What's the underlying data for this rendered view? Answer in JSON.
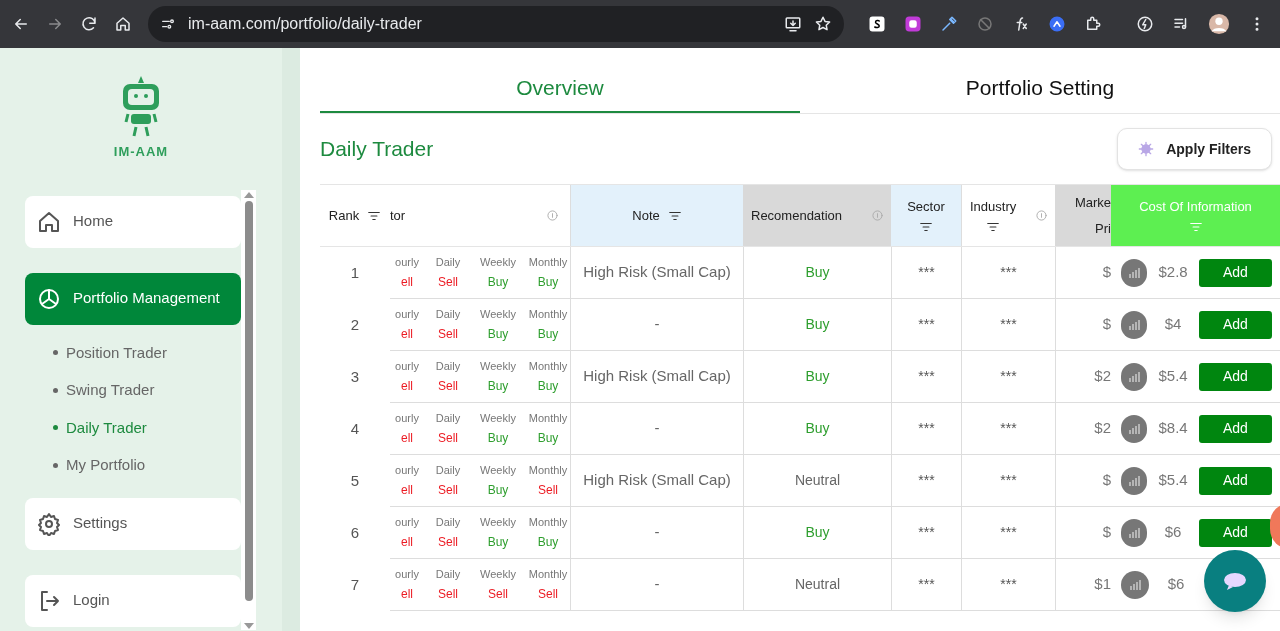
{
  "browser": {
    "url": "im-aam.com/portfolio/daily-trader"
  },
  "sidebar": {
    "logo": "IM-AAM",
    "items": [
      {
        "label": "Home",
        "kind": "home",
        "selected": false
      },
      {
        "label": "Portfolio Management",
        "kind": "chart",
        "selected": true,
        "children": [
          {
            "label": "Position Trader",
            "selected": false
          },
          {
            "label": "Swing Trader",
            "selected": false
          },
          {
            "label": "Daily Trader",
            "selected": true
          },
          {
            "label": "My Portfolio",
            "selected": false
          }
        ]
      },
      {
        "label": "Settings",
        "kind": "gear",
        "selected": false
      },
      {
        "label": "Login",
        "kind": "login",
        "selected": false
      }
    ]
  },
  "tabs": [
    {
      "label": "Overview",
      "selected": true
    },
    {
      "label": "Portfolio Setting",
      "selected": false
    }
  ],
  "title": "Daily Trader",
  "apply_filters": "Apply Filters",
  "table": {
    "columns": [
      "Rank",
      "tor",
      "Note",
      "Recomendation",
      "Sector",
      "Industry",
      "Marke",
      "Pri",
      "Cost Of Information"
    ],
    "rows": [
      {
        "rank": "1",
        "signals": [
          {
            "period": "ourly",
            "value": "ell",
            "kind": "sell"
          },
          {
            "period": "Daily",
            "value": "Sell",
            "kind": "sell"
          },
          {
            "period": "Weekly",
            "value": "Buy",
            "kind": "buy"
          },
          {
            "period": "Monthly",
            "value": "Buy",
            "kind": "buy"
          }
        ],
        "note": "High Risk (Small Cap)",
        "recommendation": {
          "label": "Buy",
          "kind": "buy"
        },
        "sector": "***",
        "industry": "***",
        "market_price": "$",
        "cost": "$2.8",
        "action": "Add"
      },
      {
        "rank": "2",
        "signals": [
          {
            "period": "ourly",
            "value": "ell",
            "kind": "sell"
          },
          {
            "period": "Daily",
            "value": "Sell",
            "kind": "sell"
          },
          {
            "period": "Weekly",
            "value": "Buy",
            "kind": "buy"
          },
          {
            "period": "Monthly",
            "value": "Buy",
            "kind": "buy"
          }
        ],
        "note": "-",
        "recommendation": {
          "label": "Buy",
          "kind": "buy"
        },
        "sector": "***",
        "industry": "***",
        "market_price": "$",
        "cost": "$4",
        "action": "Add"
      },
      {
        "rank": "3",
        "signals": [
          {
            "period": "ourly",
            "value": "ell",
            "kind": "sell"
          },
          {
            "period": "Daily",
            "value": "Sell",
            "kind": "sell"
          },
          {
            "period": "Weekly",
            "value": "Buy",
            "kind": "buy"
          },
          {
            "period": "Monthly",
            "value": "Buy",
            "kind": "buy"
          }
        ],
        "note": "High Risk (Small Cap)",
        "recommendation": {
          "label": "Buy",
          "kind": "buy"
        },
        "sector": "***",
        "industry": "***",
        "market_price": "$2",
        "cost": "$5.4",
        "action": "Add"
      },
      {
        "rank": "4",
        "signals": [
          {
            "period": "ourly",
            "value": "ell",
            "kind": "sell"
          },
          {
            "period": "Daily",
            "value": "Sell",
            "kind": "sell"
          },
          {
            "period": "Weekly",
            "value": "Buy",
            "kind": "buy"
          },
          {
            "period": "Monthly",
            "value": "Buy",
            "kind": "buy"
          }
        ],
        "note": "-",
        "recommendation": {
          "label": "Buy",
          "kind": "buy"
        },
        "sector": "***",
        "industry": "***",
        "market_price": "$2",
        "cost": "$8.4",
        "action": "Add"
      },
      {
        "rank": "5",
        "signals": [
          {
            "period": "ourly",
            "value": "ell",
            "kind": "sell"
          },
          {
            "period": "Daily",
            "value": "Sell",
            "kind": "sell"
          },
          {
            "period": "Weekly",
            "value": "Buy",
            "kind": "buy"
          },
          {
            "period": "Monthly",
            "value": "Sell",
            "kind": "sell"
          }
        ],
        "note": "High Risk (Small Cap)",
        "recommendation": {
          "label": "Neutral",
          "kind": "neutral"
        },
        "sector": "***",
        "industry": "***",
        "market_price": "$",
        "cost": "$5.4",
        "action": "Add"
      },
      {
        "rank": "6",
        "signals": [
          {
            "period": "ourly",
            "value": "ell",
            "kind": "sell"
          },
          {
            "period": "Daily",
            "value": "Sell",
            "kind": "sell"
          },
          {
            "period": "Weekly",
            "value": "Buy",
            "kind": "buy"
          },
          {
            "period": "Monthly",
            "value": "Buy",
            "kind": "buy"
          }
        ],
        "note": "-",
        "recommendation": {
          "label": "Buy",
          "kind": "buy"
        },
        "sector": "***",
        "industry": "***",
        "market_price": "$",
        "cost": "$6",
        "action": "Add"
      },
      {
        "rank": "7",
        "signals": [
          {
            "period": "ourly",
            "value": "ell",
            "kind": "sell"
          },
          {
            "period": "Daily",
            "value": "Sell",
            "kind": "sell"
          },
          {
            "period": "Weekly",
            "value": "Sell",
            "kind": "sell"
          },
          {
            "period": "Monthly",
            "value": "Sell",
            "kind": "sell"
          }
        ],
        "note": "-",
        "recommendation": {
          "label": "Neutral",
          "kind": "neutral"
        },
        "sector": "***",
        "industry": "***",
        "market_price": "$1",
        "cost": "$6",
        "action": null
      }
    ]
  }
}
